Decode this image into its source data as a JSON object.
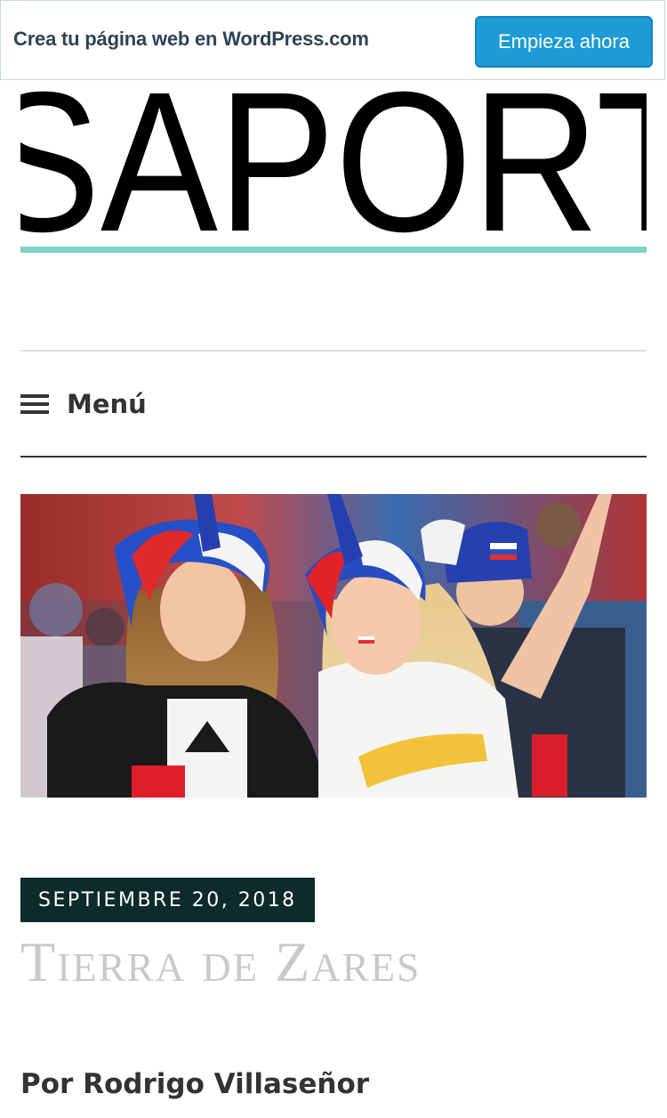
{
  "banner": {
    "promo_text": "Crea tu página web en WordPress.com",
    "cta_label": "Empieza ahora"
  },
  "site": {
    "logo_text": "SAPORT",
    "accent_color": "#7fd3c4"
  },
  "nav": {
    "menu_label": "Menú",
    "menu_icon": "hamburger-icon"
  },
  "post": {
    "featured_image": "photo-of-fans-with-painted-flags-and-feather-hats",
    "date": "SEPTIEMBRE 20, 2018",
    "title": "Tierra de Zares",
    "byline_prefix": "Por",
    "author": "Rodrigo Villaseñor"
  }
}
